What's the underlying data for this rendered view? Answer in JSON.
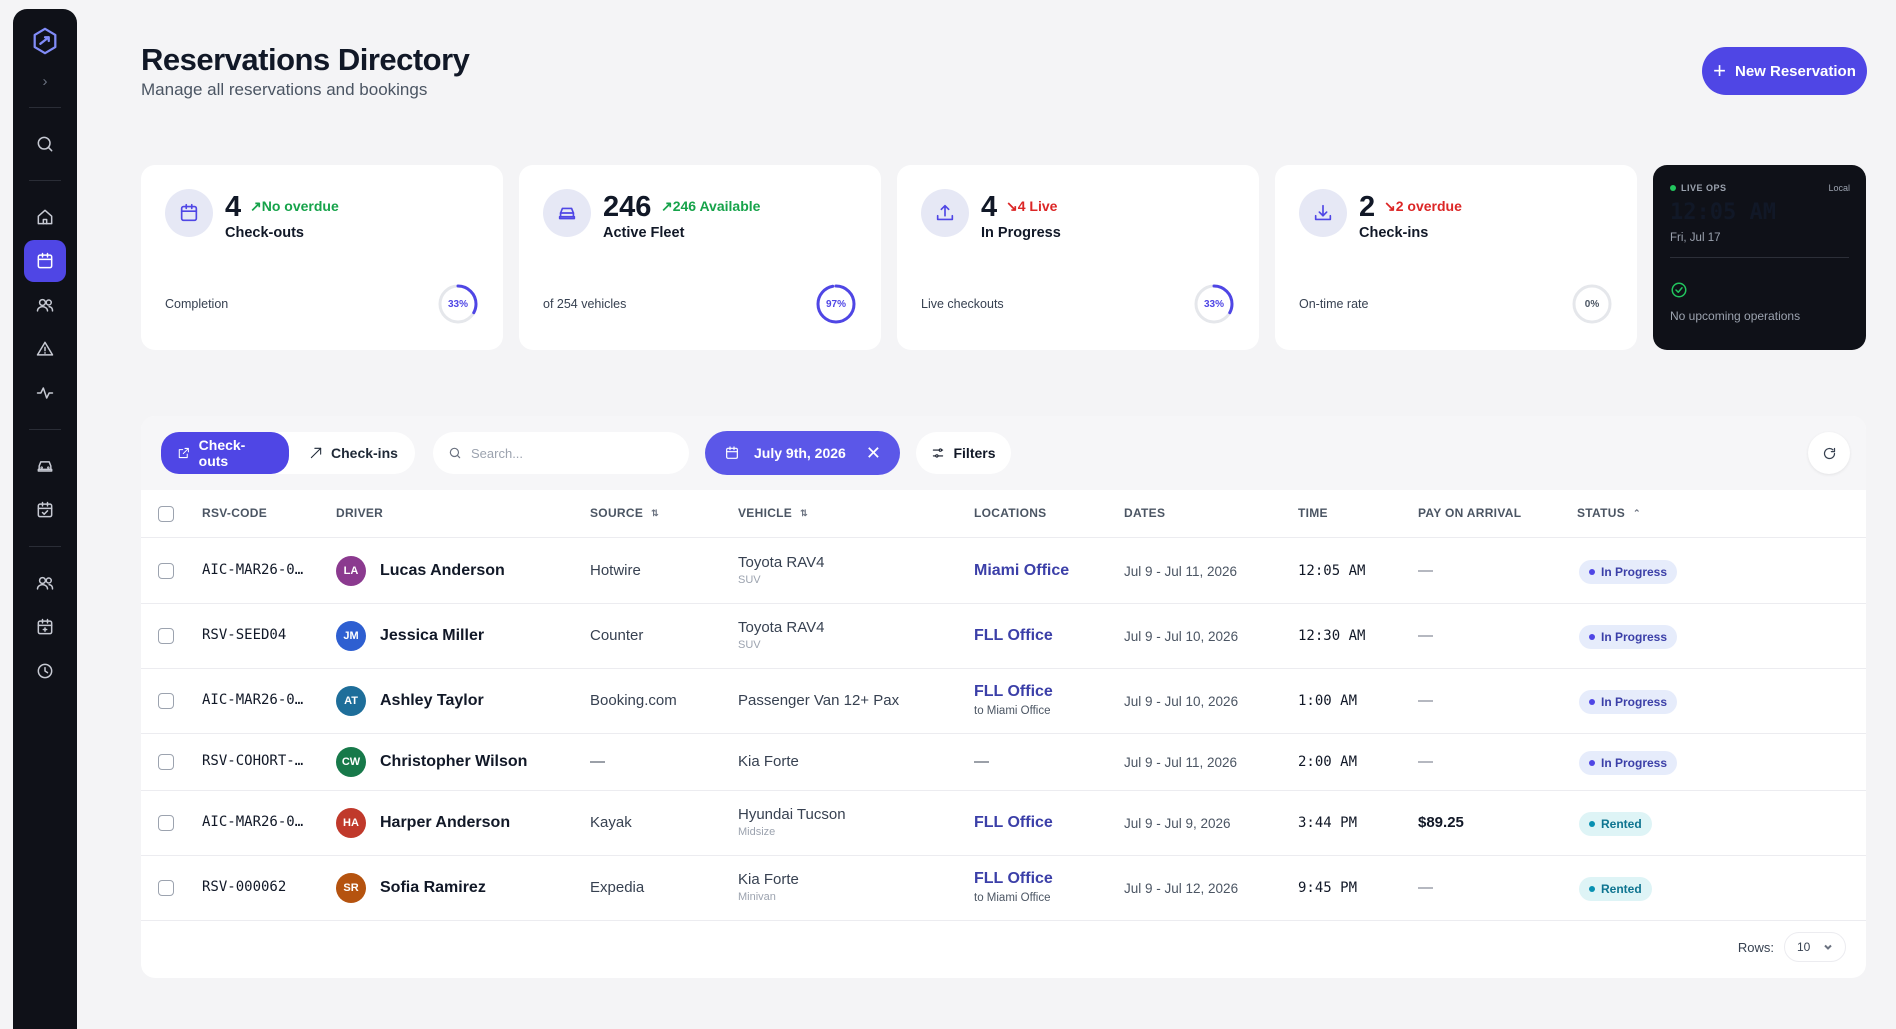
{
  "header": {
    "title": "Reservations Directory",
    "subtitle": "Manage all reservations and bookings",
    "new_button": "New Reservation"
  },
  "stats": [
    {
      "icon": "calendar-icon",
      "value": "4",
      "trend": "No overdue",
      "trend_dir": "up",
      "label": "Check-outs",
      "footer": "Completion",
      "percent_label": "33%",
      "percent": 33
    },
    {
      "icon": "car-icon",
      "value": "246",
      "trend": "246 Available",
      "trend_dir": "up",
      "label": "Active Fleet",
      "footer": "of 254 vehicles",
      "percent_label": "97%",
      "percent": 97
    },
    {
      "icon": "upload-icon",
      "value": "4",
      "trend": "4 Live",
      "trend_dir": "down",
      "label": "In Progress",
      "footer": "Live checkouts",
      "percent_label": "33%",
      "percent": 33
    },
    {
      "icon": "download-icon",
      "value": "2",
      "trend": "2 overdue",
      "trend_dir": "down",
      "label": "Check-ins",
      "footer": "On-time rate",
      "percent_label": "0%",
      "percent": 0
    }
  ],
  "live_ops": {
    "tag": "LIVE OPS",
    "zone": "Local",
    "time": "12:05 AM",
    "date": "Fri, Jul 17",
    "message": "No upcoming operations"
  },
  "toolbar": {
    "tab_checkouts": "Check-outs",
    "tab_checkins": "Check-ins",
    "search_placeholder": "Search...",
    "date_filter": "July 9th, 2026",
    "filters": "Filters"
  },
  "table": {
    "headers": {
      "code": "RSV-CODE",
      "driver": "DRIVER",
      "source": "SOURCE",
      "vehicle": "VEHICLE",
      "locations": "LOCATIONS",
      "dates": "DATES",
      "time": "TIME",
      "pay": "PAY ON ARRIVAL",
      "status": "STATUS"
    },
    "rows": [
      {
        "code": "AIC-MAR26-0…",
        "initials": "LA",
        "avatar_color": "#8b3a8f",
        "driver": "Lucas Anderson",
        "source": "Hotwire",
        "vehicle": "Toyota RAV4",
        "vehicle_class": "SUV",
        "location": "Miami Office",
        "location_sub": "",
        "dates": "Jul 9 - Jul 11, 2026",
        "time": "12:05 AM",
        "pay": "—",
        "status": "In Progress"
      },
      {
        "code": "RSV-SEED04",
        "initials": "JM",
        "avatar_color": "#2e5fd1",
        "driver": "Jessica Miller",
        "source": "Counter",
        "vehicle": "Toyota RAV4",
        "vehicle_class": "SUV",
        "location": "FLL Office",
        "location_sub": "",
        "dates": "Jul 9 - Jul 10, 2026",
        "time": "12:30 AM",
        "pay": "—",
        "status": "In Progress"
      },
      {
        "code": "AIC-MAR26-0…",
        "initials": "AT",
        "avatar_color": "#1e6e9a",
        "driver": "Ashley Taylor",
        "source": "Booking.com",
        "vehicle": "Passenger Van 12+ Pax",
        "vehicle_class": "",
        "location": "FLL Office",
        "location_sub": "to Miami Office",
        "dates": "Jul 9 - Jul 10, 2026",
        "time": "1:00 AM",
        "pay": "—",
        "status": "In Progress"
      },
      {
        "code": "RSV-COHORT-…",
        "initials": "CW",
        "avatar_color": "#17794a",
        "driver": "Christopher Wilson",
        "source": "—",
        "vehicle": "Kia Forte",
        "vehicle_class": "",
        "location": "—",
        "location_sub": "",
        "dates": "Jul 9 - Jul 11, 2026",
        "time": "2:00 AM",
        "pay": "—",
        "status": "In Progress"
      },
      {
        "code": "AIC-MAR26-0…",
        "initials": "HA",
        "avatar_color": "#c0392b",
        "driver": "Harper Anderson",
        "source": "Kayak",
        "vehicle": "Hyundai Tucson",
        "vehicle_class": "Midsize",
        "location": "FLL Office",
        "location_sub": "",
        "dates": "Jul 9 - Jul 9, 2026",
        "time": "3:44 PM",
        "pay": "$89.25",
        "status": "Rented"
      },
      {
        "code": "RSV-000062",
        "initials": "SR",
        "avatar_color": "#b5530f",
        "driver": "Sofia Ramirez",
        "source": "Expedia",
        "vehicle": "Kia Forte",
        "vehicle_class": "Minivan",
        "location": "FLL Office",
        "location_sub": "to Miami Office",
        "dates": "Jul 9 - Jul 12, 2026",
        "time": "9:45 PM",
        "pay": "—",
        "status": "Rented"
      }
    ]
  },
  "pagination": {
    "rows_label": "Rows:",
    "rows_value": "10"
  }
}
